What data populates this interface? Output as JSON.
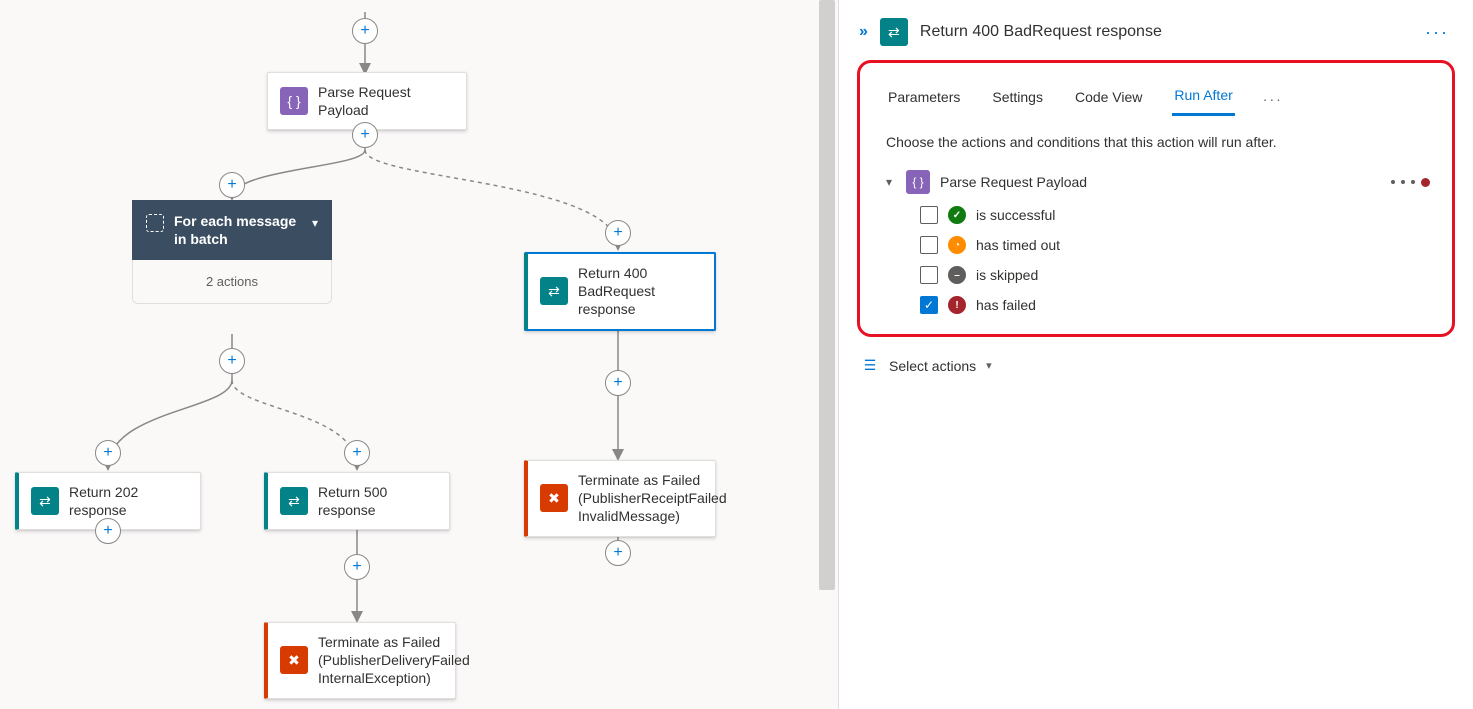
{
  "canvas": {
    "nodes": {
      "parse": "Parse Request Payload",
      "foreach_title": "For each message in batch",
      "foreach_body": "2 actions",
      "return400": "Return 400 BadRequest response",
      "return202": "Return 202 response",
      "return500": "Return 500 response",
      "terminate1": "Terminate as Failed (PublisherReceiptFailed InvalidMessage)",
      "terminate2": "Terminate as Failed (PublisherDeliveryFailed InternalException)"
    }
  },
  "panel": {
    "title": "Return 400 BadRequest response",
    "tabs": {
      "parameters": "Parameters",
      "settings": "Settings",
      "codeview": "Code View",
      "runafter": "Run After"
    },
    "hint": "Choose the actions and conditions that this action will run after.",
    "prev_action": "Parse Request Payload",
    "options": {
      "ok": "is successful",
      "time": "has timed out",
      "skip": "is skipped",
      "fail": "has failed"
    },
    "select_actions": "Select actions"
  }
}
